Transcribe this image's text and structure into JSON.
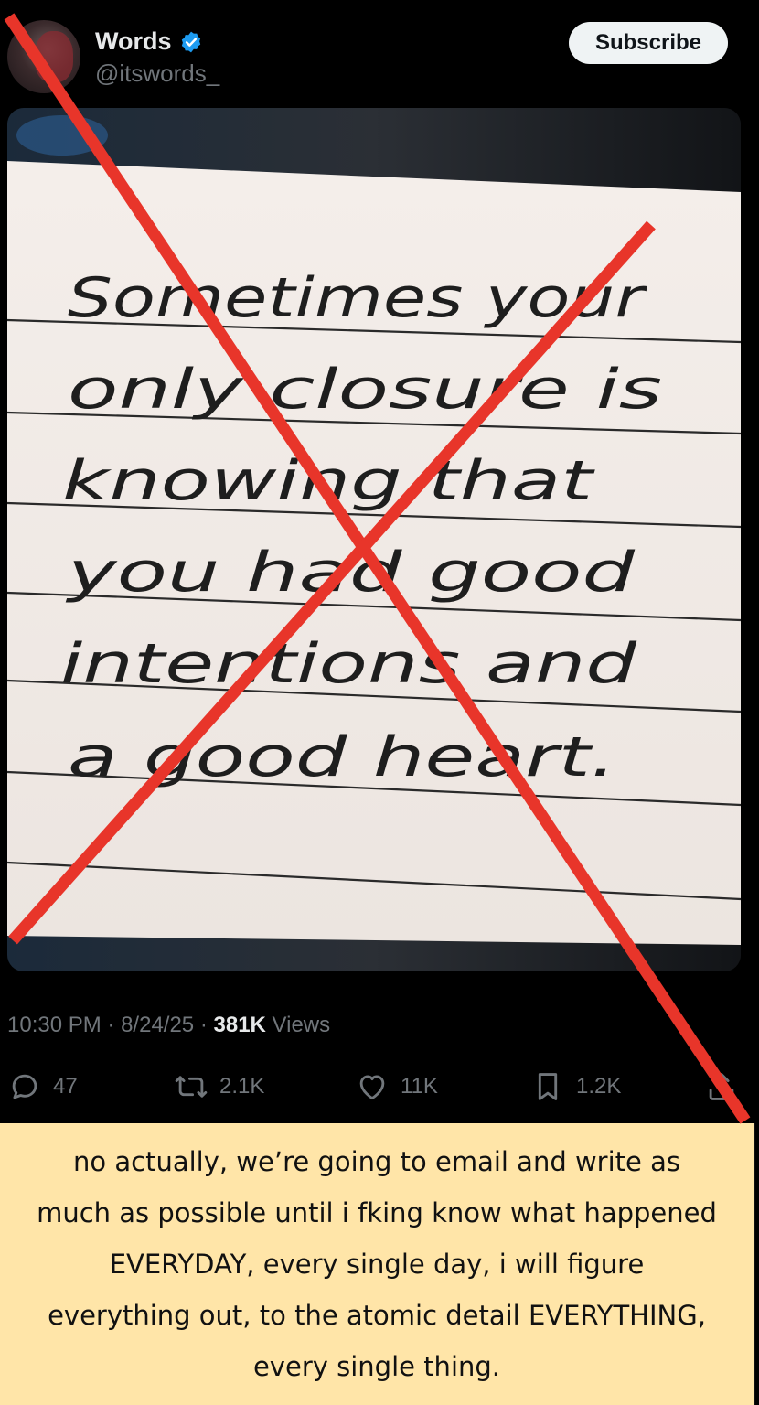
{
  "tweet": {
    "display_name": "Words",
    "handle": "@itswords_",
    "subscribe_label": "Subscribe",
    "note_lines": [
      "Sometimes your",
      "only closure is",
      "knowing that",
      "you had good",
      "intentions and",
      "a good heart."
    ],
    "time": "10:30 PM",
    "date": "8/24/25",
    "views_count": "381K",
    "views_label": "Views",
    "replies": "47",
    "reposts": "2.1K",
    "likes": "11K",
    "bookmarks": "1.2K"
  },
  "caption": {
    "text": "no actually, we’re going to email and write as much as possible until i fking know what happened EVERYDAY, every single day, i will figure everything out, to the atomic detail EVERYTHING, every single thing."
  },
  "colors": {
    "background": "#000000",
    "caption_bg": "#ffe5a8",
    "x_mark": "#e8352a",
    "verified": "#1d9bf0",
    "muted_text": "#71767b"
  },
  "icons": [
    "verified-badge-icon",
    "reply-icon",
    "repost-icon",
    "like-icon",
    "bookmark-icon",
    "share-icon"
  ]
}
